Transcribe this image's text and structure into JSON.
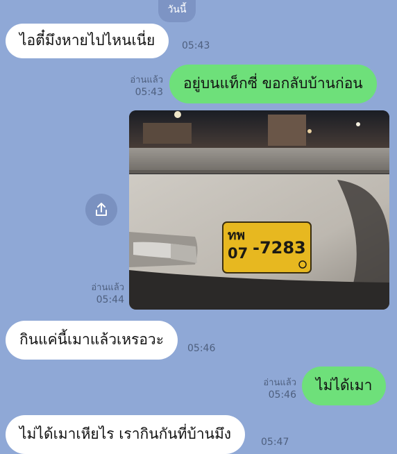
{
  "date_separator": "วันนี้",
  "messages": [
    {
      "id": "m1",
      "direction": "incoming",
      "text": "ไอตี๋มึงหายไปไหนเนี่ย",
      "time": "05:43"
    },
    {
      "id": "m2",
      "direction": "outgoing",
      "text": "อยู่บนแท็กซี่ ขอกลับบ้านก่อน",
      "read": "อ่านแล้ว",
      "time": "05:43"
    },
    {
      "id": "m3",
      "direction": "outgoing",
      "type": "photo",
      "read": "อ่านแล้ว",
      "time": "05:44",
      "plate_line1": "ทพ",
      "plate_line2": "07",
      "plate_number": "-7283"
    },
    {
      "id": "m4",
      "direction": "incoming",
      "text": "กินแค่นี้เมาแล้วเหรอวะ",
      "time": "05:46"
    },
    {
      "id": "m5",
      "direction": "outgoing",
      "text": "ไม่ได้เมา",
      "read": "อ่านแล้ว",
      "time": "05:46"
    },
    {
      "id": "m6",
      "direction": "incoming",
      "text": "ไม่ได้เมาเหียไร เรากินกันที่บ้านมึง",
      "time": "05:47"
    }
  ],
  "icons": {
    "share": "share-icon"
  },
  "colors": {
    "background": "#8fa8d6",
    "incoming_bubble": "#ffffff",
    "outgoing_bubble": "#6ee07a"
  }
}
